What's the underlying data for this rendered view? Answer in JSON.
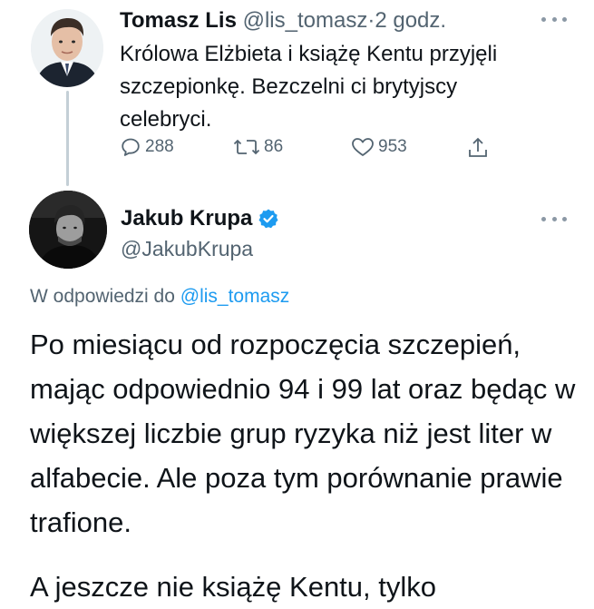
{
  "tweet1": {
    "author_name": "Tomasz Lis",
    "handle": "@lis_tomasz",
    "separator": "·",
    "time": "2 godz.",
    "text": "Królowa Elżbieta i książę Kentu  przyjęli szczepionkę. Bezczelni ci brytyjscy celebryci.",
    "replies": "288",
    "retweets": "86",
    "likes": "953"
  },
  "tweet2": {
    "author_name": "Jakub Krupa",
    "handle": "@JakubKrupa",
    "verified": true,
    "reply_to_prefix": "W odpowiedzi do ",
    "reply_to_handle": "@lis_tomasz",
    "paragraph1": "Po miesiącu od rozpoczęcia szczepień, mając odpowiednio 94 i 99 lat oraz będąc w większej liczbie grup ryzyka niż jest liter w alfabecie. Ale poza tym porównanie prawie trafione.",
    "paragraph2": "A jeszcze nie książę Kentu, tylko"
  },
  "colors": {
    "text": "#0f1419",
    "secondary": "#536471",
    "accent": "#1d9bf0",
    "thread_line": "#c4cfd6"
  },
  "icons": [
    "reply-icon",
    "retweet-icon",
    "like-icon",
    "share-icon",
    "verified-badge-icon",
    "more-icon"
  ]
}
